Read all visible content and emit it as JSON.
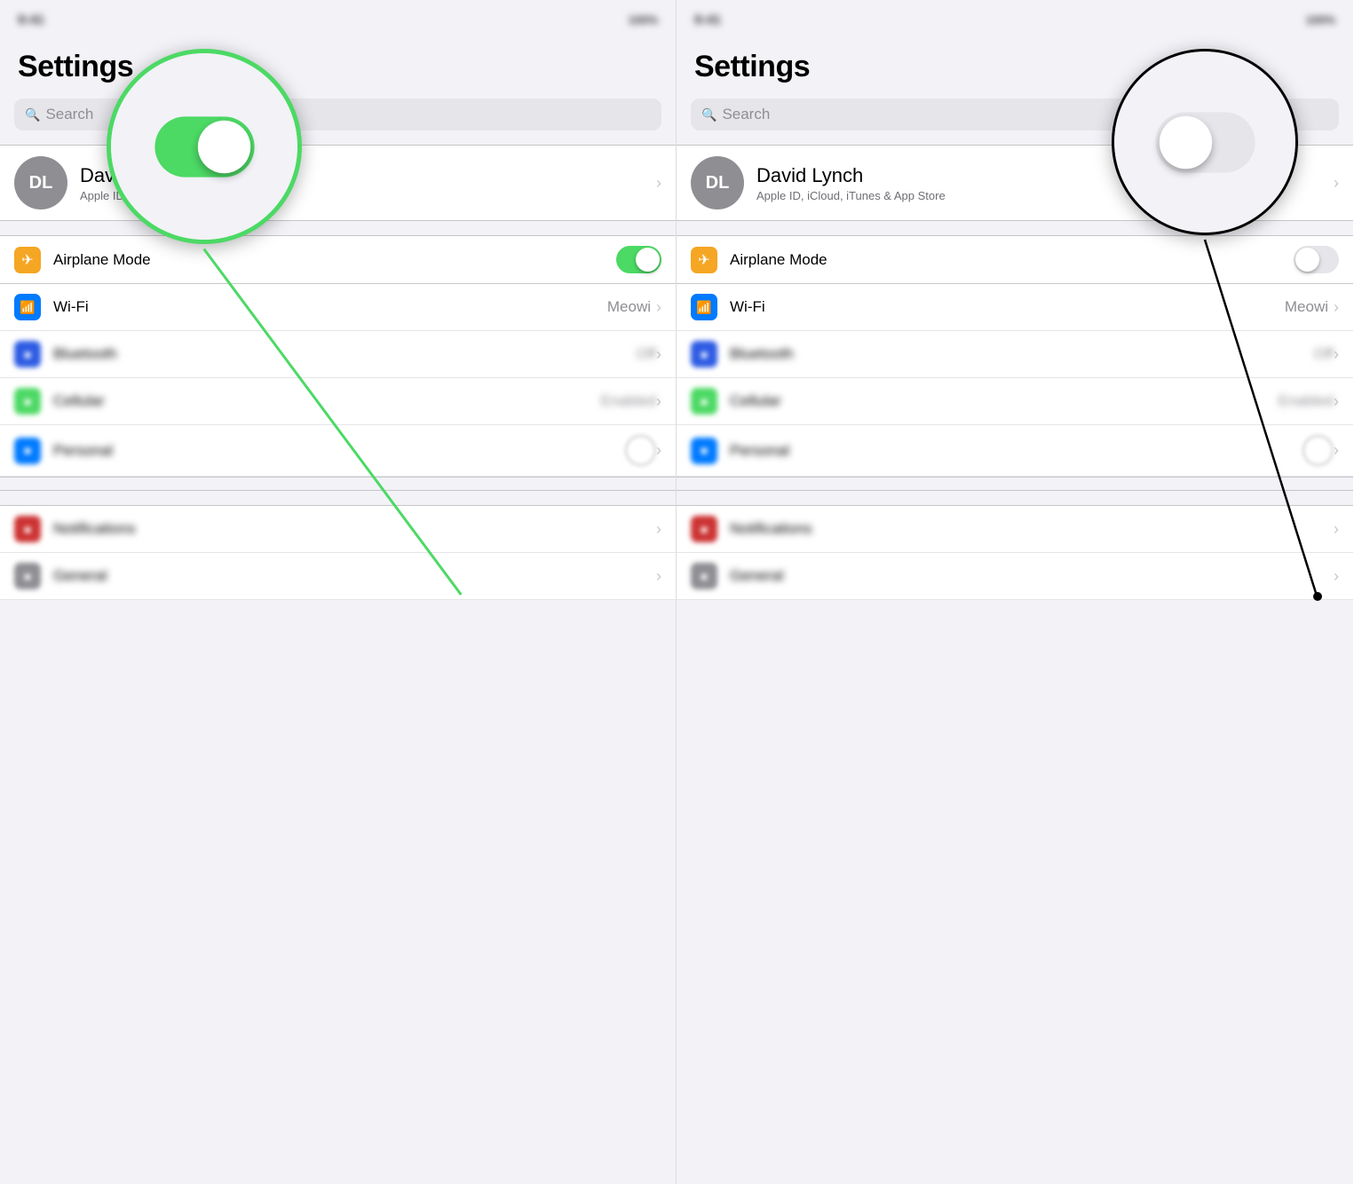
{
  "left_panel": {
    "status_bar": {
      "left_text": "9:41",
      "right_text": "100%"
    },
    "title": "Settings",
    "search_placeholder": "Search",
    "profile": {
      "initials": "DL",
      "name": "David Lynch",
      "subtitle": "Apple ID, iCloud, iTunes & App Store"
    },
    "airplane_mode": {
      "label": "Airplane Mode",
      "toggle_state": "on"
    },
    "wifi_row": {
      "label": "Wi-Fi",
      "value": "Meowi"
    },
    "magnifier_toggle_state": "on"
  },
  "right_panel": {
    "status_bar": {
      "left_text": "9:41",
      "right_text": "100%"
    },
    "title": "Settings",
    "search_placeholder": "Search",
    "profile": {
      "initials": "DL",
      "name": "David Lynch",
      "subtitle": "Apple ID, iCloud, iTunes & App Store"
    },
    "airplane_mode": {
      "label": "Airplane Mode",
      "toggle_state": "off"
    },
    "wifi_row": {
      "label": "Wi-Fi",
      "value": "Meowi"
    },
    "magnifier_toggle_state": "off"
  },
  "icons": {
    "airplane": "✈",
    "wifi": "📶",
    "search": "🔍",
    "chevron": "›"
  },
  "colors": {
    "toggle_on": "#4cd964",
    "toggle_off": "#e5e5ea",
    "orange": "#f5a623",
    "blue": "#007aff",
    "green_border": "#4cd964",
    "black_border": "#000000"
  }
}
